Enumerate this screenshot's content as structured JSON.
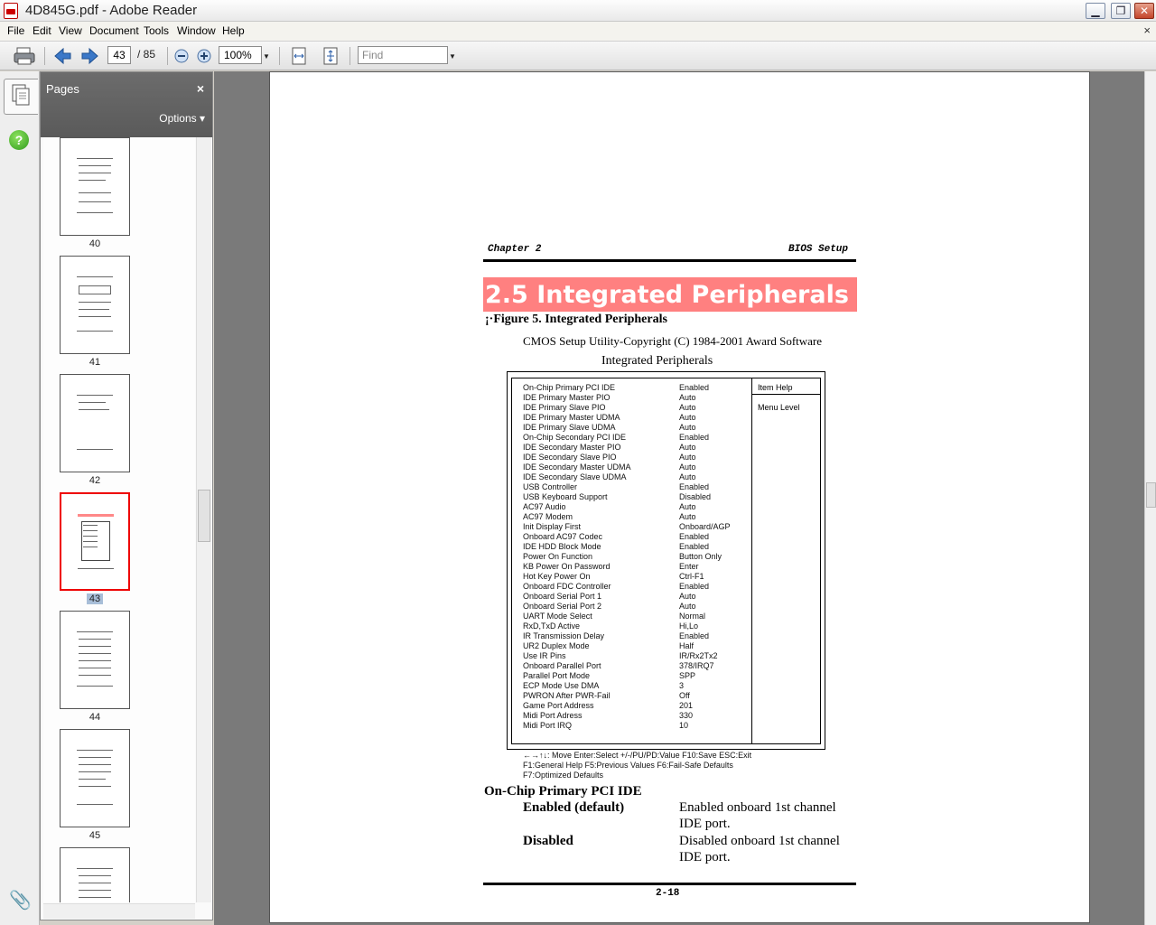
{
  "window": {
    "title": "4D845G.pdf - Adobe Reader",
    "min": "▁",
    "max": "❐",
    "close": "✕"
  },
  "menu": {
    "items": [
      "File",
      "Edit",
      "View",
      "Document",
      "Tools",
      "Window",
      "Help"
    ],
    "close": "×"
  },
  "toolbar": {
    "page_current": "43",
    "page_total": "/ 85",
    "zoom": "100%",
    "find_placeholder": "Find"
  },
  "panel": {
    "title": "Pages",
    "close": "×",
    "options": "Options ▾",
    "help": "?"
  },
  "thumbnails": [
    {
      "label": "40",
      "selected": false
    },
    {
      "label": "41",
      "selected": false
    },
    {
      "label": "42",
      "selected": false
    },
    {
      "label": "43",
      "selected": true
    },
    {
      "label": "44",
      "selected": false
    },
    {
      "label": "45",
      "selected": false
    },
    {
      "label": "",
      "selected": false
    }
  ],
  "doc": {
    "header_left": "Chapter 2",
    "header_right": "BIOS Setup",
    "section_title": "2.5 Integrated Peripherals",
    "figure_caption": "¡·Figure 5. Integrated Peripherals",
    "cmos_title": "CMOS Setup Utility-Copyright (C) 1984-2001 Award Software",
    "screen_title": "Integrated Peripherals",
    "item_help": "Item Help",
    "menu_level": "Menu Level",
    "bios_items": [
      {
        "name": "On-Chip Primary PCI IDE",
        "value": "Enabled"
      },
      {
        "name": "IDE Primary Master PIO",
        "value": "Auto"
      },
      {
        "name": "IDE Primary Slave PIO",
        "value": "Auto"
      },
      {
        "name": "IDE Primary Master UDMA",
        "value": "Auto"
      },
      {
        "name": "IDE Primary Slave UDMA",
        "value": "Auto"
      },
      {
        "name": "On-Chip Secondary PCI IDE",
        "value": "Enabled"
      },
      {
        "name": "IDE Secondary Master PIO",
        "value": "Auto"
      },
      {
        "name": "IDE Secondary Slave PIO",
        "value": "Auto"
      },
      {
        "name": "IDE Secondary Master UDMA",
        "value": "Auto"
      },
      {
        "name": "IDE Secondary Slave UDMA",
        "value": "Auto"
      },
      {
        "name": "USB Controller",
        "value": "Enabled"
      },
      {
        "name": "USB Keyboard Support",
        "value": "Disabled"
      },
      {
        "name": "AC97 Audio",
        "value": "Auto"
      },
      {
        "name": "AC97 Modem",
        "value": "Auto"
      },
      {
        "name": "Init Display First",
        "value": "Onboard/AGP"
      },
      {
        "name": "Onboard AC97 Codec",
        "value": "Enabled"
      },
      {
        "name": "IDE HDD Block Mode",
        "value": "Enabled"
      },
      {
        "name": "Power On Function",
        "value": "Button Only"
      },
      {
        "name": "KB Power On Password",
        "value": "Enter"
      },
      {
        "name": "Hot Key Power On",
        "value": "Ctrl-F1"
      },
      {
        "name": "Onboard FDC Controller",
        "value": "Enabled"
      },
      {
        "name": "Onboard Serial Port 1",
        "value": "Auto"
      },
      {
        "name": "Onboard Serial Port 2",
        "value": "Auto"
      },
      {
        "name": "UART Mode Select",
        "value": "Normal"
      },
      {
        "name": "RxD,TxD Active",
        "value": "Hi,Lo"
      },
      {
        "name": "IR Transmission Delay",
        "value": "Enabled"
      },
      {
        "name": "UR2 Duplex Mode",
        "value": "Half"
      },
      {
        "name": "Use IR Pins",
        "value": "IR/Rx2Tx2"
      },
      {
        "name": "Onboard Parallel Port",
        "value": "378/IRQ7"
      },
      {
        "name": "Parallel Port Mode",
        "value": "SPP"
      },
      {
        "name": "ECP Mode Use DMA",
        "value": "3"
      },
      {
        "name": "PWRON After PWR-Fail",
        "value": "Off"
      },
      {
        "name": "Game Port Address",
        "value": "201"
      },
      {
        "name": "Midi Port Adress",
        "value": "330"
      },
      {
        "name": "Midi Port IRQ",
        "value": "10"
      }
    ],
    "keys": [
      "←→↑↓: Move    Enter:Select    +/-/PU/PD:Value    F10:Save    ESC:Exit",
      "F1:General Help    F5:Previous Values    F6:Fail-Safe Defaults",
      "F7:Optimized Defaults"
    ],
    "option_heading": "On-Chip Primary PCI IDE",
    "options": [
      {
        "term": "Enabled (default)",
        "desc1": "Enabled onboard 1st channel",
        "desc2": "IDE port."
      },
      {
        "term": "Disabled",
        "desc1": "Disabled onboard 1st channel",
        "desc2": "IDE port."
      }
    ],
    "page_number": "2-18"
  }
}
